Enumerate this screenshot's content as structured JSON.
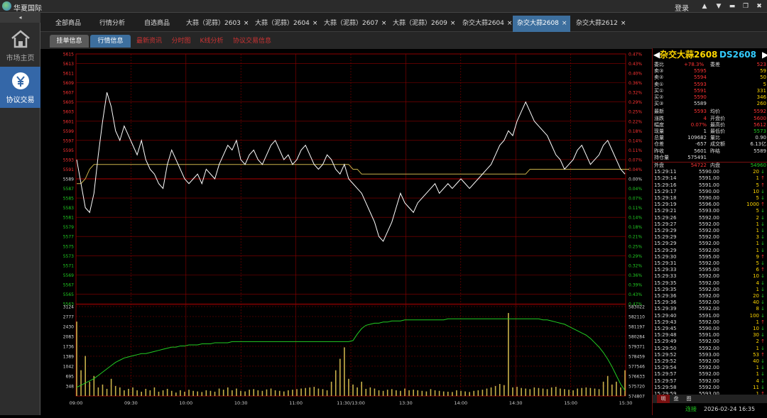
{
  "app": {
    "title": "华夏国际",
    "login": "登录"
  },
  "sidebar": {
    "collapse": "◂",
    "items": [
      {
        "label": "市场主页",
        "active": false
      },
      {
        "label": "协议交易",
        "active": true
      }
    ]
  },
  "tabs": [
    {
      "label": "全部商品",
      "close": false,
      "active": false
    },
    {
      "label": "行情分析",
      "close": false,
      "active": false
    },
    {
      "label": "自选商品",
      "close": false,
      "active": false
    },
    {
      "label": "大蒜（泥蒜）2603",
      "close": true,
      "active": false
    },
    {
      "label": "大蒜（泥蒜）2604",
      "close": true,
      "active": false
    },
    {
      "label": "大蒜（泥蒜）2607",
      "close": true,
      "active": false
    },
    {
      "label": "大蒜（泥蒜）2609",
      "close": true,
      "active": false
    },
    {
      "label": "杂交大蒜2604",
      "close": true,
      "active": false
    },
    {
      "label": "杂交大蒜2608",
      "close": true,
      "active": true
    },
    {
      "label": "杂交大蒜2612",
      "close": true,
      "active": false
    }
  ],
  "subtabs": [
    {
      "label": "挂单信息",
      "style": "gray"
    },
    {
      "label": "行情信息",
      "style": "blue"
    },
    {
      "label": "最新资讯",
      "style": "red"
    },
    {
      "label": "分时图",
      "style": "red"
    },
    {
      "label": "K线分析",
      "style": "red"
    },
    {
      "label": "协议交易信息",
      "style": "red"
    }
  ],
  "colors": {
    "up": "#ff3333",
    "down": "#22cc22",
    "grid": "#8b0000",
    "price": "#ffffff",
    "avg": "#c9b14a",
    "volume": "#c9b14a",
    "oi": "#22cc22"
  },
  "chart_data": {
    "type": "line",
    "price_axis": {
      "left": [
        "5615",
        "5613",
        "5611",
        "5609",
        "5607",
        "5605",
        "5603",
        "5601",
        "5599",
        "5597",
        "5595",
        "5593",
        "5591",
        "5589",
        "5587",
        "5585",
        "5583",
        "5581",
        "5579",
        "5577",
        "5575",
        "5573",
        "5571",
        "5569",
        "5567",
        "5565",
        "5563"
      ],
      "right": [
        "0.47%",
        "0.43%",
        "0.40%",
        "0.36%",
        "0.32%",
        "0.29%",
        "0.25%",
        "0.22%",
        "0.18%",
        "0.14%",
        "0.11%",
        "0.07%",
        "0.04%",
        "0.00%",
        "0.04%",
        "0.07%",
        "0.11%",
        "0.14%",
        "0.18%",
        "0.21%",
        "0.25%",
        "0.29%",
        "0.32%",
        "0.36%",
        "0.39%",
        "0.43%",
        "0.47%"
      ],
      "reference": 5589
    },
    "volume_axis": {
      "left": [
        "3124",
        "2777",
        "2430",
        "2083",
        "1736",
        "1389",
        "1042",
        "695",
        "348"
      ],
      "right": [
        "583022",
        "582110",
        "581197",
        "580284",
        "579371",
        "578459",
        "577546",
        "576633",
        "575720",
        "574807"
      ]
    },
    "time_labels": [
      "09:00",
      "09:30",
      "10:00",
      "10:30",
      "11:00",
      "11:30/13:00",
      "13:30",
      "14:00",
      "14:30",
      "15:00",
      "15:30"
    ],
    "series": [
      {
        "name": "price",
        "values": [
          5593,
          5588,
          5583,
          5582,
          5586,
          5594,
          5601,
          5607,
          5604,
          5599,
          5597,
          5600,
          5598,
          5596,
          5594,
          5597,
          5593,
          5591,
          5590,
          5588,
          5587,
          5592,
          5595,
          5593,
          5591,
          5589,
          5588,
          5589,
          5590,
          5588,
          5591,
          5590,
          5589,
          5592,
          5594,
          5596,
          5595,
          5597,
          5593,
          5592,
          5594,
          5595,
          5593,
          5592,
          5594,
          5596,
          5597,
          5595,
          5593,
          5594,
          5592,
          5593,
          5595,
          5596,
          5594,
          5592,
          5591,
          5592,
          5594,
          5593,
          5591,
          5590,
          5592,
          5589,
          5588,
          5587,
          5586,
          5584,
          5582,
          5580,
          5577,
          5576,
          5578,
          5580,
          5583,
          5586,
          5584,
          5583,
          5582,
          5584,
          5585,
          5586,
          5587,
          5588,
          5586,
          5587,
          5588,
          5587,
          5588,
          5589,
          5588,
          5587,
          5588,
          5589,
          5590,
          5591,
          5592,
          5594,
          5596,
          5597,
          5599,
          5598,
          5601,
          5603,
          5605,
          5603,
          5601,
          5600,
          5599,
          5598,
          5596,
          5594,
          5593,
          5591,
          5592,
          5593,
          5595,
          5596,
          5594,
          5592,
          5593,
          5594,
          5596,
          5597,
          5595,
          5593,
          5591,
          5590
        ]
      },
      {
        "name": "average",
        "values": [
          5588,
          5588,
          5589,
          5591,
          5592,
          5592,
          5592,
          5592,
          5592,
          5592,
          5592,
          5592,
          5592,
          5592,
          5592,
          5592,
          5592,
          5592,
          5592,
          5592,
          5592,
          5592,
          5592,
          5592,
          5592,
          5592,
          5592,
          5592,
          5592,
          5592,
          5592,
          5592,
          5592,
          5592,
          5592,
          5592,
          5592,
          5592,
          5592,
          5592,
          5592,
          5592,
          5592,
          5592,
          5592,
          5592,
          5592,
          5592,
          5592,
          5592,
          5592,
          5592,
          5592,
          5592,
          5592,
          5592,
          5592,
          5592,
          5592,
          5592,
          5592,
          5592,
          5592,
          5592,
          5591,
          5591,
          5590,
          5590,
          5590,
          5590,
          5590,
          5590,
          5590,
          5590,
          5590,
          5590,
          5590,
          5590,
          5590,
          5590,
          5590,
          5590,
          5590,
          5590,
          5590,
          5590,
          5590,
          5590,
          5590,
          5590,
          5590,
          5590,
          5590,
          5590,
          5590,
          5590,
          5590,
          5590,
          5590,
          5590,
          5590,
          5590,
          5590,
          5590,
          5590,
          5591,
          5591,
          5591,
          5591,
          5591,
          5591,
          5591,
          5591,
          5591,
          5591,
          5591,
          5591,
          5591,
          5591,
          5591,
          5591,
          5591,
          5591,
          5591,
          5591,
          5591,
          5591,
          5591,
          5591
        ]
      },
      {
        "name": "volume",
        "values": [
          2600,
          900,
          1400,
          500,
          700,
          300,
          400,
          250,
          600,
          350,
          300,
          200,
          250,
          300,
          200,
          150,
          250,
          200,
          300,
          150,
          200,
          250,
          180,
          120,
          200,
          150,
          220,
          180,
          160,
          140,
          200,
          180,
          150,
          260,
          220,
          300,
          200,
          260,
          180,
          160,
          220,
          240,
          200,
          180,
          230,
          260,
          200,
          180,
          160,
          200,
          220,
          240,
          260,
          280,
          300,
          320,
          260,
          240,
          200,
          500,
          900,
          1300,
          1700,
          600,
          400,
          300,
          500,
          250,
          300,
          260,
          200,
          180,
          220,
          240,
          200,
          180,
          260,
          200,
          220,
          200,
          180,
          160,
          240,
          200,
          180,
          160,
          150,
          140,
          200,
          180,
          160,
          140,
          180,
          200,
          220,
          260,
          300,
          350,
          420,
          380,
          2900,
          300,
          320,
          280,
          260,
          240,
          300,
          280,
          260,
          240,
          300,
          320,
          260,
          240,
          220,
          200,
          260,
          280,
          300,
          280,
          260,
          240,
          500,
          700,
          400,
          500,
          300,
          900
        ]
      },
      {
        "name": "open_interest",
        "values": [
          575600,
          575800,
          576000,
          576200,
          576400,
          576700,
          577000,
          577300,
          577600,
          577900,
          578100,
          578300,
          578400,
          578500,
          578600,
          578700,
          578700,
          578800,
          578900,
          579000,
          579100,
          579200,
          579300,
          579300,
          579400,
          579400,
          579500,
          579500,
          579500,
          579600,
          579600,
          579600,
          579700,
          579700,
          579700,
          579700,
          579800,
          579800,
          579800,
          579800,
          579800,
          579800,
          579800,
          579800,
          579800,
          579800,
          579800,
          579800,
          579800,
          579800,
          579800,
          579800,
          579800,
          579800,
          579800,
          579800,
          579800,
          579800,
          579800,
          579800,
          579800,
          579800,
          579800,
          579800,
          579900,
          580500,
          581000,
          581300,
          581400,
          581500,
          581500,
          581600,
          581600,
          581700,
          581700,
          581700,
          581800,
          581800,
          581800,
          581800,
          581800,
          581800,
          581800,
          581800,
          581800,
          581800,
          581900,
          581900,
          581900,
          581900,
          581900,
          581900,
          581900,
          581900,
          581900,
          581900,
          581900,
          581900,
          581900,
          581900,
          581900,
          581900,
          581900,
          581900,
          581900,
          581900,
          581900,
          581900,
          581800,
          581800,
          581700,
          581600,
          581500,
          581400,
          581200,
          581000,
          580800,
          580600,
          580400,
          580100,
          579700,
          579300,
          578800,
          578200,
          577500,
          576700,
          575900,
          575300
        ]
      }
    ]
  },
  "panel": {
    "name": "杂交大蒜2608",
    "code": "DS2608",
    "header_row": {
      "l1": "委比",
      "v1": "+78.3%",
      "l2": "委差",
      "v2": "523"
    },
    "book": [
      {
        "label": "卖③",
        "price": "5595",
        "qty": "59",
        "color": "#ff3333"
      },
      {
        "label": "卖②",
        "price": "5594",
        "qty": "50",
        "color": "#ff3333"
      },
      {
        "label": "卖①",
        "price": "5593",
        "qty": "5",
        "color": "#ff3333"
      },
      {
        "label": "买①",
        "price": "5591",
        "qty": "331",
        "color": "#ff3333"
      },
      {
        "label": "买②",
        "price": "5590",
        "qty": "346",
        "color": "#ff3333"
      },
      {
        "label": "买③",
        "price": "5589",
        "qty": "260",
        "color": "#dddddd"
      }
    ],
    "stats": [
      {
        "l1": "最新",
        "v1": "5593",
        "c1": "#ff3333",
        "l2": "均价",
        "v2": "5592",
        "c2": "#ff3333"
      },
      {
        "l1": "涨跌",
        "v1": "4",
        "c1": "#ff3333",
        "l2": "开盘价",
        "v2": "5600",
        "c2": "#ff3333"
      },
      {
        "l1": "幅度",
        "v1": "0.07%",
        "c1": "#ff3333",
        "l2": "最高价",
        "v2": "5612",
        "c2": "#ff3333"
      },
      {
        "l1": "现量",
        "v1": "1",
        "c1": "#dddddd",
        "l2": "最低价",
        "v2": "5573",
        "c2": "#22cc22"
      },
      {
        "l1": "总量",
        "v1": "109682",
        "c1": "#dddddd",
        "l2": "量比",
        "v2": "0.90",
        "c2": "#dddddd"
      },
      {
        "l1": "仓差",
        "v1": "-657",
        "c1": "#dddddd",
        "l2": "成交额",
        "v2": "6.13亿",
        "c2": "#dddddd"
      },
      {
        "l1": "昨收",
        "v1": "5601",
        "c1": "#dddddd",
        "l2": "昨结",
        "v2": "5589",
        "c2": "#dddddd"
      },
      {
        "l1": "持仓量",
        "v1": "575491",
        "c1": "#dddddd",
        "l2": "",
        "v2": "",
        "c2": "#dddddd"
      }
    ],
    "outin": {
      "l1": "外盘",
      "v1": "54722",
      "l2": "内盘",
      "v2": "54960"
    },
    "ticks": [
      {
        "time": "15:29:11",
        "price": "5590.00",
        "qty": "20",
        "dir": "↓"
      },
      {
        "time": "15:29:14",
        "price": "5591.00",
        "qty": "1",
        "dir": "↑"
      },
      {
        "time": "15:29:16",
        "price": "5591.00",
        "qty": "5",
        "dir": "↑"
      },
      {
        "time": "15:29:17",
        "price": "5590.00",
        "qty": "10",
        "dir": "↓"
      },
      {
        "time": "15:29:18",
        "price": "5590.00",
        "qty": "5",
        "dir": "↓"
      },
      {
        "time": "15:29:19",
        "price": "5596.00",
        "qty": "1000",
        "dir": "↑"
      },
      {
        "time": "15:29:21",
        "price": "5593.00",
        "qty": "5",
        "dir": "↓"
      },
      {
        "time": "15:29:26",
        "price": "5592.00",
        "qty": "2",
        "dir": "↓"
      },
      {
        "time": "15:29:27",
        "price": "5592.00",
        "qty": "1",
        "dir": "↓"
      },
      {
        "time": "15:29:29",
        "price": "5592.00",
        "qty": "1",
        "dir": "↓"
      },
      {
        "time": "15:29:29",
        "price": "5592.00",
        "qty": "3",
        "dir": "↓"
      },
      {
        "time": "15:29:29",
        "price": "5592.00",
        "qty": "1",
        "dir": "↓"
      },
      {
        "time": "15:29:29",
        "price": "5592.00",
        "qty": "1",
        "dir": "↓"
      },
      {
        "time": "15:29:30",
        "price": "5595.00",
        "qty": "9",
        "dir": "↑"
      },
      {
        "time": "15:29:31",
        "price": "5592.00",
        "qty": "5",
        "dir": "↓"
      },
      {
        "time": "15:29:33",
        "price": "5595.00",
        "qty": "6",
        "dir": "↑"
      },
      {
        "time": "15:29:33",
        "price": "5592.00",
        "qty": "10",
        "dir": "↓"
      },
      {
        "time": "15:29:35",
        "price": "5592.00",
        "qty": "4",
        "dir": "↓"
      },
      {
        "time": "15:29:35",
        "price": "5592.00",
        "qty": "1",
        "dir": "↓"
      },
      {
        "time": "15:29:36",
        "price": "5592.00",
        "qty": "20",
        "dir": "↓"
      },
      {
        "time": "15:29:36",
        "price": "5592.00",
        "qty": "40",
        "dir": "↓"
      },
      {
        "time": "15:29:39",
        "price": "5592.00",
        "qty": "8",
        "dir": "↓"
      },
      {
        "time": "15:29:40",
        "price": "5591.00",
        "qty": "100",
        "dir": "↓"
      },
      {
        "time": "15:29:43",
        "price": "5592.00",
        "qty": "1",
        "dir": "↑"
      },
      {
        "time": "15:29:45",
        "price": "5590.00",
        "qty": "10",
        "dir": "↓"
      },
      {
        "time": "15:29:48",
        "price": "5591.00",
        "qty": "30",
        "dir": "↓"
      },
      {
        "time": "15:29:49",
        "price": "5592.00",
        "qty": "2",
        "dir": "↑"
      },
      {
        "time": "15:29:50",
        "price": "5592.00",
        "qty": "1",
        "dir": "↓"
      },
      {
        "time": "15:29:52",
        "price": "5593.00",
        "qty": "53",
        "dir": "↑"
      },
      {
        "time": "15:29:52",
        "price": "5592.00",
        "qty": "40",
        "dir": "↓"
      },
      {
        "time": "15:29:54",
        "price": "5592.00",
        "qty": "1",
        "dir": "↓"
      },
      {
        "time": "15:29:57",
        "price": "5592.00",
        "qty": "1",
        "dir": "↓"
      },
      {
        "time": "15:29:57",
        "price": "5592.00",
        "qty": "4",
        "dir": "↓"
      },
      {
        "time": "15:29:58",
        "price": "5592.00",
        "qty": "11",
        "dir": "↓"
      },
      {
        "time": "15:29:59",
        "price": "5593.00",
        "qty": "1",
        "dir": "↑"
      }
    ],
    "tabs": [
      "明",
      "盘",
      "图"
    ],
    "status": {
      "conn": "连接",
      "datetime": "2026-02-24 16:35"
    }
  }
}
